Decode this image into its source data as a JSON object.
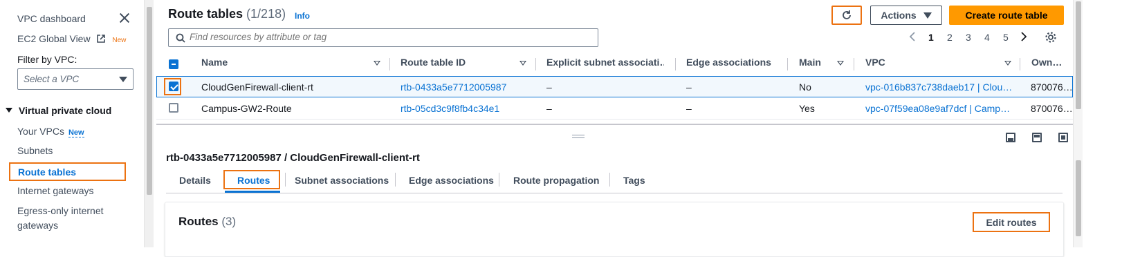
{
  "sidebar": {
    "vpc_dashboard": "VPC dashboard",
    "ec2_global_view": "EC2 Global View",
    "new_badge": "New",
    "filter_label": "Filter by VPC:",
    "filter_placeholder": "Select a VPC",
    "section": "Virtual private cloud",
    "your_vpcs": "Your VPCs",
    "your_vpcs_badge": "New",
    "subnets": "Subnets",
    "route_tables": "Route tables",
    "internet_gateways": "Internet gateways",
    "egress_only_line1": "Egress-only internet",
    "egress_only_line2": "gateways"
  },
  "header": {
    "title": "Route tables",
    "count": "(1/218)",
    "info": "Info",
    "actions": "Actions",
    "create": "Create route table",
    "search_placeholder": "Find resources by attribute or tag",
    "pages": [
      "1",
      "2",
      "3",
      "4",
      "5"
    ]
  },
  "table": {
    "columns": [
      "Name",
      "Route table ID",
      "Explicit subnet associati…",
      "Edge associations",
      "Main",
      "VPC",
      "Own…"
    ],
    "rows": [
      {
        "name": "CloudGenFirewall-client-rt",
        "id": "rtb-0433a5e7712005987",
        "explicit": "–",
        "edge": "–",
        "main": "No",
        "vpc": "vpc-016b837c738daeb17 | Clou…",
        "owner": "870076…",
        "selected": true
      },
      {
        "name": "Campus-GW2-Route",
        "id": "rtb-05cd3c9f8fb4c34e1",
        "explicit": "–",
        "edge": "–",
        "main": "Yes",
        "vpc": "vpc-07f59ea08e9af7dcf | Camp…",
        "owner": "870076…",
        "selected": false
      }
    ]
  },
  "detail": {
    "title": "rtb-0433a5e7712005987 / CloudGenFirewall-client-rt",
    "tabs": [
      "Details",
      "Routes",
      "Subnet associations",
      "Edge associations",
      "Route propagation",
      "Tags"
    ],
    "active_tab": "Routes",
    "routes_title": "Routes",
    "routes_count": "(3)",
    "edit_routes": "Edit routes"
  },
  "colors": {
    "accent": "#0972d3",
    "highlight": "#ec7211",
    "primary_button": "#ff9900"
  }
}
